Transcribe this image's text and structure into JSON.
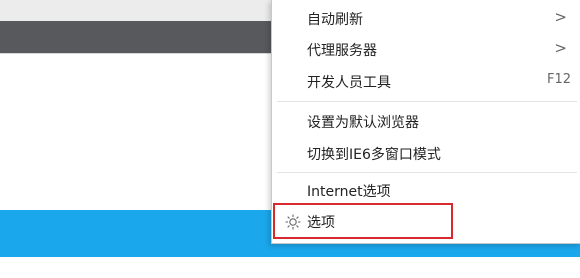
{
  "menu": {
    "items": [
      {
        "label": "自动刷新",
        "submenu": ">"
      },
      {
        "label": "代理服务器",
        "submenu": ">"
      },
      {
        "label": "开发人员工具",
        "shortcut": "F12"
      },
      {
        "label": "设置为默认浏览器"
      },
      {
        "label": "切换到IE6多窗口模式"
      },
      {
        "label": "Internet选项"
      },
      {
        "label": "选项",
        "icon": "gear-icon"
      }
    ]
  },
  "colors": {
    "accent_band": "#1aa7ec",
    "highlight": "#d8292f",
    "tabstrip": "#58595d"
  }
}
